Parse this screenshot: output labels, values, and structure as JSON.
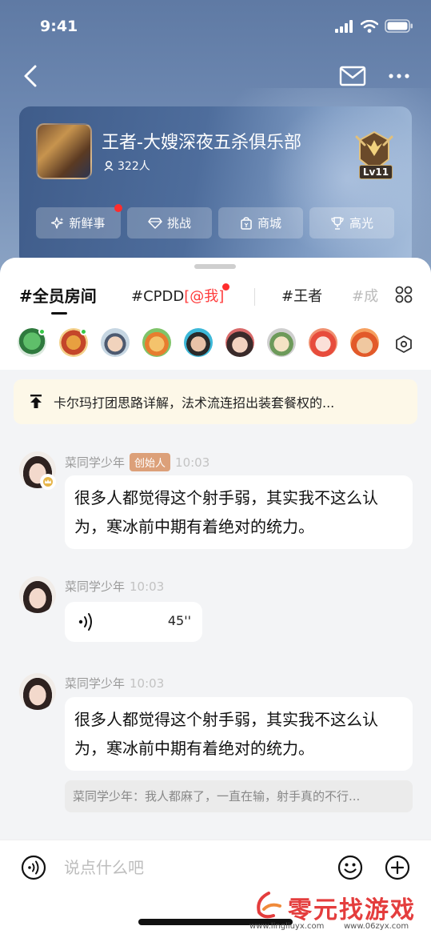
{
  "status_bar": {
    "time": "9:41"
  },
  "club": {
    "name": "王者-大嫂深夜五杀俱乐部",
    "members": "322人",
    "level": "Lv11",
    "buttons": [
      {
        "label": "新鲜事",
        "icon": "sparkle-icon",
        "has_dot": true
      },
      {
        "label": "挑战",
        "icon": "diamond-icon",
        "has_dot": false
      },
      {
        "label": "商城",
        "icon": "shop-icon",
        "has_dot": false
      },
      {
        "label": "高光",
        "icon": "trophy-icon",
        "has_dot": false
      }
    ]
  },
  "tabs": {
    "active": "#全员房间",
    "cpdd": "#CPDD",
    "cpdd_mention": "[@我]",
    "wangzhe": "#王者",
    "faded": "#成"
  },
  "pinned": {
    "text": "卡尔玛打团思路详解，法术流连招出装套餐权的..."
  },
  "messages": [
    {
      "user": "菜同学少年",
      "tag": "创始人",
      "time": "10:03",
      "text": "很多人都觉得这个射手弱，其实我不这么认为，寒冰前中期有着绝对的统力。"
    },
    {
      "user": "菜同学少年",
      "time": "10:03",
      "voice_duration": "45''"
    },
    {
      "user": "菜同学少年",
      "time": "10:03",
      "text": "很多人都觉得这个射手弱，其实我不这么认为，寒冰前中期有着绝对的统力。",
      "quote": "菜同学少年：我人都麻了，一直在输，射手真的不行..."
    }
  ],
  "input": {
    "placeholder": "说点什么吧"
  },
  "watermark": {
    "title": "零元找游戏",
    "url1": "www.lingliuyx.com",
    "url2": "www.06zyx.com"
  },
  "colors": {
    "accent_red": "#ff2d2d",
    "founder_tag": "#dca079",
    "online": "#38c848",
    "pinned_bg": "#fdf8e8"
  }
}
